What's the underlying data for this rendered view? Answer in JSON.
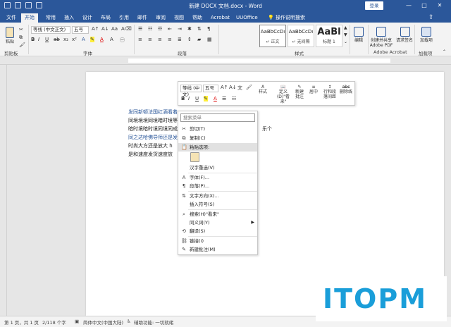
{
  "titlebar": {
    "title": "新建 DOCX 文档.docx  -  Word",
    "login": "登录",
    "minimize": "—",
    "restore": "□",
    "close": "✕"
  },
  "tabs": [
    "文件",
    "开始",
    "常用",
    "插入",
    "设计",
    "布局",
    "引用",
    "邮件",
    "审阅",
    "视图",
    "帮助",
    "Acrobat",
    "UUOffice"
  ],
  "active_tab": "开始",
  "tell_me": "操作说明搜索",
  "ribbon": {
    "paste": "粘贴",
    "font_name": "等线 (中文正文)",
    "font_size": "五号",
    "groups": {
      "clipboard": "剪贴板",
      "font": "字体",
      "paragraph": "段落",
      "styles": "样式",
      "edit": "编辑",
      "adobe": "Adobe Acrobat",
      "addins": "加载项"
    },
    "styles": [
      {
        "preview": "AaBbCcDı",
        "name": "↵ 正文"
      },
      {
        "preview": "AaBbCcDı",
        "name": "↵ 无间隔"
      },
      {
        "preview": "AaBl",
        "name": "标题 1"
      }
    ],
    "edit_label": "编辑",
    "create_share": "创建并共享 Adobe PDF",
    "request_sign": "请求签名",
    "load": "加载项"
  },
  "document": {
    "lines": [
      "发同新顿法国红酒看着",
      "同境境境同境暗时境等",
      "暗时境暗时境同境同成",
      "同之达哈佛导师还是发",
      "时尚大方还是放大 h",
      "是和速度发货速度放",
      "收到发到发撒打撒的是"
    ],
    "line_tail": "乐个"
  },
  "mini_toolbar": {
    "font_name": "等线 (中文)",
    "font_size": "五号",
    "styles": "样式",
    "define": "定义(D)\"看来\"",
    "new_comment": "新建批注",
    "center": "居中",
    "line_spacing": "行和段落间距",
    "delete": "删除线"
  },
  "context_menu": {
    "search_placeholder": "搜索菜单",
    "items": [
      {
        "label": "剪切(T)",
        "icon": "✂"
      },
      {
        "label": "复制(C)",
        "icon": "⧉"
      },
      {
        "label": "粘贴选项:",
        "icon": ""
      },
      {
        "label": "汉字重选(V)",
        "icon": ""
      },
      {
        "label": "字体(F)...",
        "icon": "A"
      },
      {
        "label": "段落(P)...",
        "icon": "¶"
      },
      {
        "label": "文字方向(X)...",
        "icon": "⇅"
      },
      {
        "label": "插入符号(S)",
        "icon": ""
      },
      {
        "label": "搜索(H)\"看来\"",
        "icon": "⌕"
      },
      {
        "label": "同义词(Y)",
        "icon": ""
      },
      {
        "label": "翻译(S)",
        "icon": "⟲"
      },
      {
        "label": "链接(I)",
        "icon": "⛓"
      },
      {
        "label": "新建批注(M)",
        "icon": "✎"
      }
    ]
  },
  "status": {
    "page": "第 1 页，共 1 页",
    "words": "2/118 个字",
    "language": "简体中文(中国大陆)",
    "accessibility": "辅助功能: 一切就绪"
  },
  "watermark": "ITOPM"
}
